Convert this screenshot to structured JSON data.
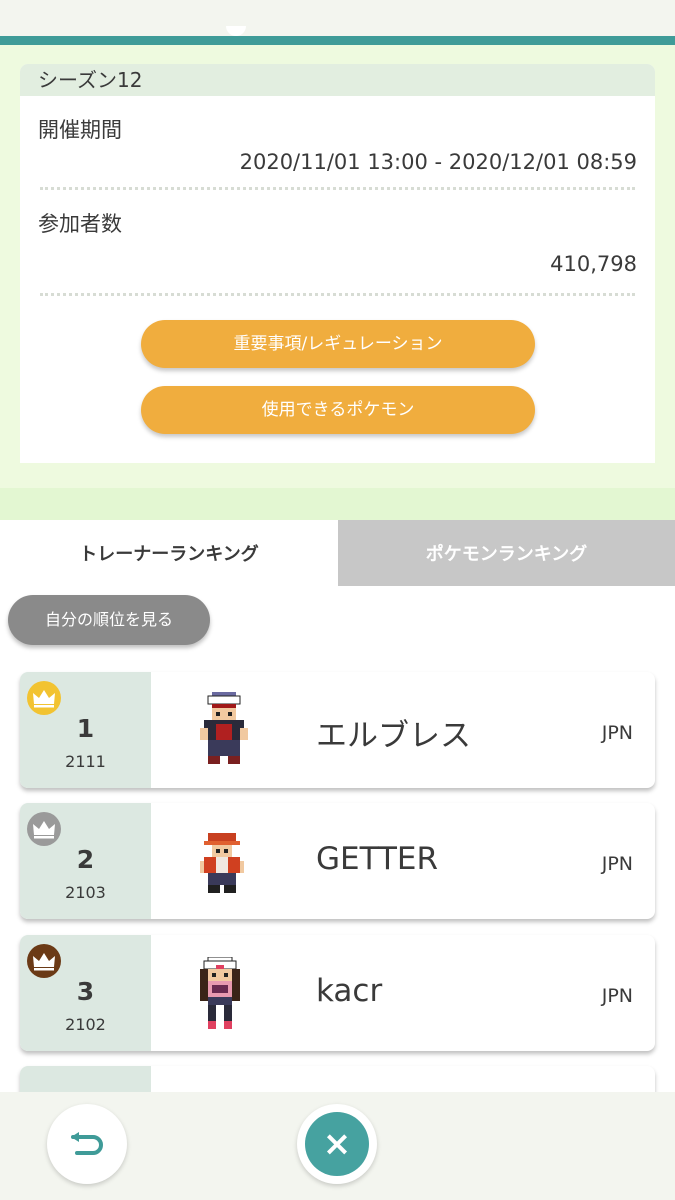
{
  "season": {
    "title": "シーズン12",
    "period_label": "開催期間",
    "period_value": "2020/11/01 13:00 - 2020/12/01 08:59",
    "participants_label": "参加者数",
    "participants_value": "410,798",
    "buttons": {
      "regulation": "重要事項/レギュレーション",
      "usable_pokemon": "使用できるポケモン"
    }
  },
  "tabs": {
    "trainer_ranking": "トレーナーランキング",
    "pokemon_ranking": "ポケモンランキング"
  },
  "view_own_rank": "自分の順位を見る",
  "rankings": [
    {
      "rank": "1",
      "rating": "2111",
      "name": "エルブレス",
      "country": "JPN",
      "crown": "gold"
    },
    {
      "rank": "2",
      "rating": "2103",
      "name": "GETTER",
      "country": "JPN",
      "crown": "silver"
    },
    {
      "rank": "3",
      "rating": "2102",
      "name": "kacr",
      "country": "JPN",
      "crown": "bronze"
    }
  ],
  "colors": {
    "teal": "#3f9b98",
    "orange": "#f0ad3e",
    "gold": "#f2c331",
    "silver": "#9a9a9a",
    "bronze": "#6b3a16"
  },
  "footer": {
    "back_icon": "return-arrow-icon",
    "close_icon": "close-icon"
  }
}
